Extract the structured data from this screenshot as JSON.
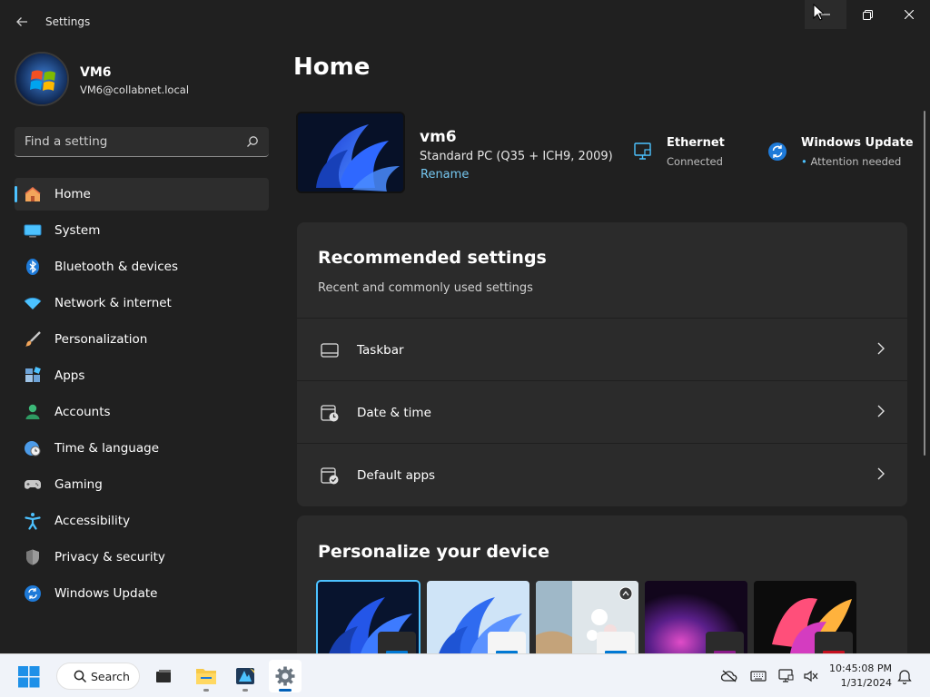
{
  "window": {
    "title": "Settings"
  },
  "profile": {
    "name": "VM6",
    "email": "VM6@collabnet.local"
  },
  "search": {
    "placeholder": "Find a setting"
  },
  "nav": [
    {
      "label": "Home",
      "icon": "home-icon",
      "active": true
    },
    {
      "label": "System",
      "icon": "system-icon"
    },
    {
      "label": "Bluetooth & devices",
      "icon": "bluetooth-icon"
    },
    {
      "label": "Network & internet",
      "icon": "wifi-icon"
    },
    {
      "label": "Personalization",
      "icon": "brush-icon"
    },
    {
      "label": "Apps",
      "icon": "apps-icon"
    },
    {
      "label": "Accounts",
      "icon": "person-icon"
    },
    {
      "label": "Time & language",
      "icon": "clock-globe-icon"
    },
    {
      "label": "Gaming",
      "icon": "gamepad-icon"
    },
    {
      "label": "Accessibility",
      "icon": "accessibility-icon"
    },
    {
      "label": "Privacy & security",
      "icon": "shield-icon"
    },
    {
      "label": "Windows Update",
      "icon": "update-icon"
    }
  ],
  "main": {
    "title": "Home",
    "device": {
      "name": "vm6",
      "model": "Standard PC (Q35 + ICH9, 2009)",
      "rename_label": "Rename"
    },
    "status": {
      "ethernet": {
        "title": "Ethernet",
        "subtitle": "Connected"
      },
      "windows_update": {
        "title": "Windows Update",
        "subtitle": "Attention needed"
      }
    },
    "recommended": {
      "title": "Recommended settings",
      "subtitle": "Recent and commonly used settings",
      "items": [
        {
          "label": "Taskbar",
          "icon": "taskbar-icon"
        },
        {
          "label": "Date & time",
          "icon": "calendar-clock-icon"
        },
        {
          "label": "Default apps",
          "icon": "default-apps-icon"
        }
      ]
    },
    "personalize": {
      "title": "Personalize your device",
      "themes": [
        {
          "name": "windows-dark-bloom",
          "selected": true,
          "accent": "#0078d4"
        },
        {
          "name": "windows-light-bloom",
          "accent": "#0078d4"
        },
        {
          "name": "windows-spotlight",
          "accent": "#0078d4"
        },
        {
          "name": "glow",
          "accent": "#8a1a8a"
        },
        {
          "name": "captured-motion",
          "accent": "#c50f1f"
        }
      ]
    }
  },
  "taskbar": {
    "search_label": "Search",
    "apps": [
      "task-view",
      "file-explorer",
      "media-app",
      "settings"
    ],
    "time": "10:45:08 PM",
    "date": "1/31/2024"
  },
  "colors": {
    "accent": "#4cc2ff",
    "link": "#75c7f0",
    "background": "#202020",
    "card": "#2b2b2b"
  }
}
